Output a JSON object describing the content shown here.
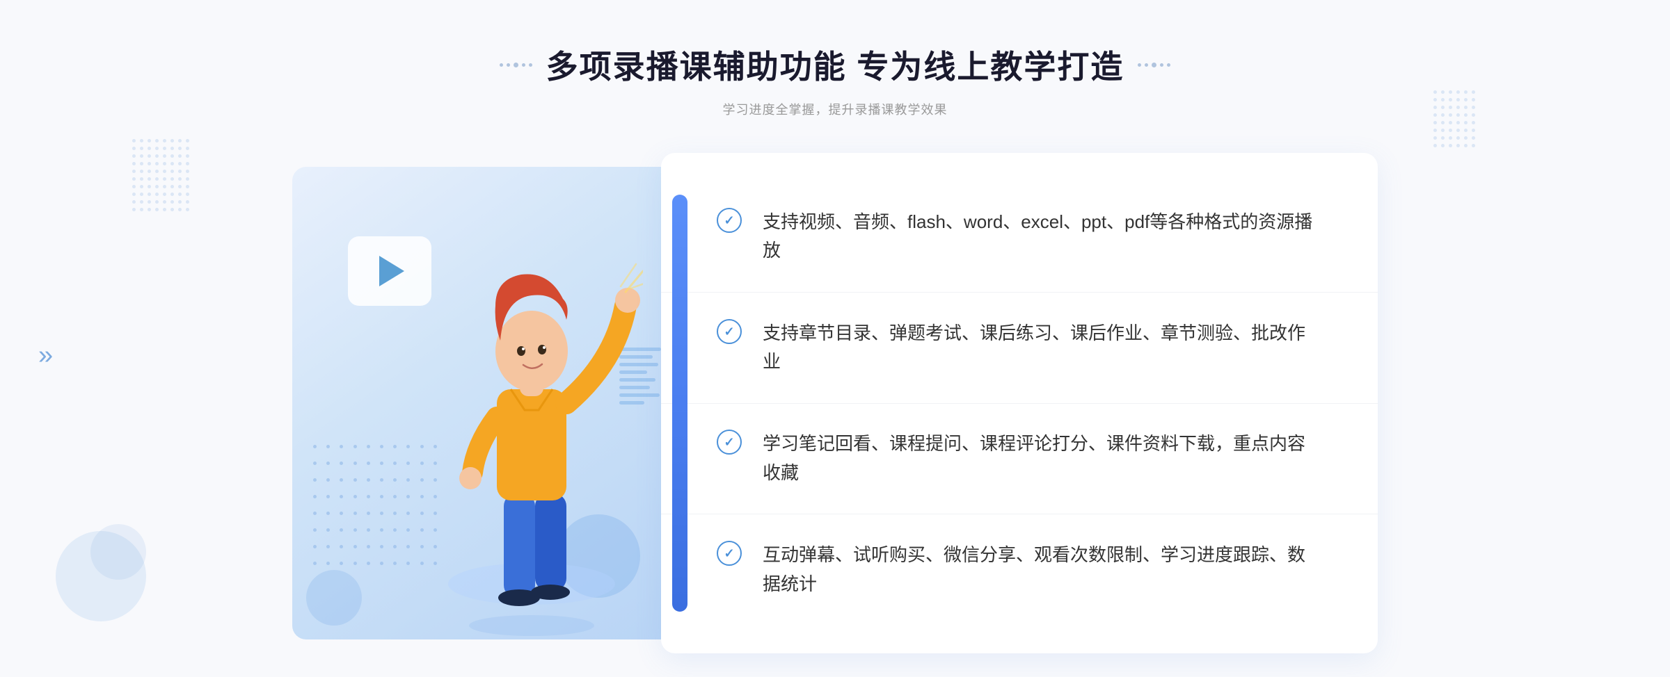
{
  "header": {
    "main_title": "多项录播课辅助功能 专为线上教学打造",
    "sub_title": "学习进度全掌握，提升录播课教学效果"
  },
  "features": [
    {
      "id": 1,
      "text": "支持视频、音频、flash、word、excel、ppt、pdf等各种格式的资源播放"
    },
    {
      "id": 2,
      "text": "支持章节目录、弹题考试、课后练习、课后作业、章节测验、批改作业"
    },
    {
      "id": 3,
      "text": "学习笔记回看、课程提问、课程评论打分、课件资料下载，重点内容收藏"
    },
    {
      "id": 4,
      "text": "互动弹幕、试听购买、微信分享、观看次数限制、学习进度跟踪、数据统计"
    }
  ],
  "decorations": {
    "chevron_left": "»",
    "check_mark": "✓"
  }
}
